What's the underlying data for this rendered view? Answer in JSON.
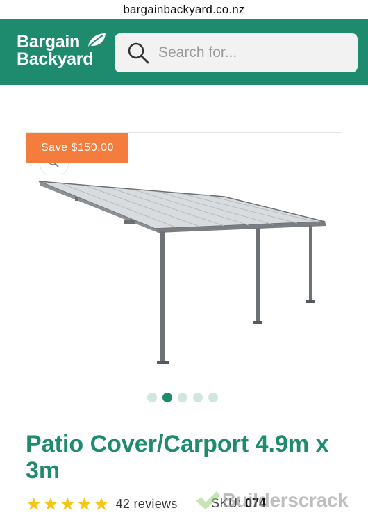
{
  "browser": {
    "url": "bargainbackyard.co.nz"
  },
  "header": {
    "brand_line1": "Bargain",
    "brand_line2": "Backyard",
    "search_placeholder": "Search for...",
    "brand_color": "#1e8a6e"
  },
  "product": {
    "save_badge": "Save $150.00",
    "badge_color": "#f47c3c",
    "title": "Patio Cover/Carport 4.9m x 3m",
    "rating": 5,
    "stars": [
      "★",
      "★",
      "★",
      "★",
      "★"
    ],
    "reviews": "42 reviews",
    "sku_label": "SKU:",
    "sku_value": "074",
    "gallery": {
      "total_images": 5,
      "active_index": 1
    }
  },
  "watermark": {
    "text": "Builderscrack"
  }
}
